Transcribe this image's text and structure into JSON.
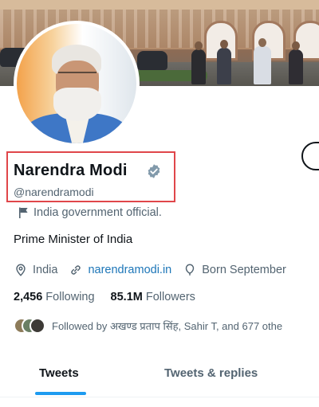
{
  "profile": {
    "display_name": "Narendra Modi",
    "handle": "@narendramodi",
    "label": "India government official.",
    "bio": "Prime Minister of India",
    "location": "India",
    "website": "narendramodi.in",
    "birth": "Born September"
  },
  "stats": {
    "following_count": "2,456",
    "following_label": "Following",
    "followers_count": "85.1M",
    "followers_label": "Followers"
  },
  "followed_by": "Followed by अखण्ड प्रताप सिंह, Sahir T, and 677 othe",
  "tabs": [
    {
      "label": "Tweets",
      "active": true
    },
    {
      "label": "Tweets & replies",
      "active": false
    }
  ],
  "colors": {
    "accent": "#1d9bf0",
    "link": "#1d76b8",
    "highlight_box": "#e0464a",
    "verified": "#829aab"
  }
}
